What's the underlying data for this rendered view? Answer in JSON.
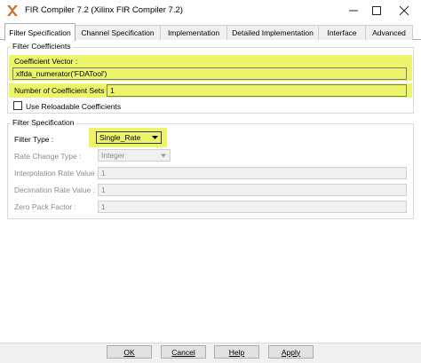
{
  "window": {
    "title": "FIR Compiler 7.2  (Xilinx FIR Compiler 7.2)",
    "minimize_icon": "minimize-icon",
    "maximize_icon": "maximize-icon",
    "close_icon": "close-icon",
    "app_icon": "xilinx-logo-icon"
  },
  "tabs": [
    {
      "label": "Filter Specification",
      "active": true
    },
    {
      "label": "Channel Specification",
      "active": false
    },
    {
      "label": "Implementation",
      "active": false
    },
    {
      "label": "Detailed Implementation",
      "active": false
    },
    {
      "label": "Interface",
      "active": false
    },
    {
      "label": "Advanced",
      "active": false
    }
  ],
  "filter_coefficients": {
    "group_label": "Filter Coefficients",
    "coefficient_vector_label": "Coefficient Vector :",
    "coefficient_vector_value": "xlfda_numerator('FDATool')",
    "num_coefficient_sets_label": "Number of Coefficient Sets :",
    "num_coefficient_sets_value": "1",
    "use_reloadable_label": "Use Reloadable Coefficients",
    "use_reloadable_checked": false
  },
  "filter_specification": {
    "group_label": "Filter Specification",
    "filter_type_label": "Filter Type :",
    "filter_type_value": "Single_Rate",
    "rate_change_type_label": "Rate Change Type :",
    "rate_change_type_value": "Integer",
    "interpolation_rate_label": "Interpolation Rate Value :",
    "interpolation_rate_value": "1",
    "decimation_rate_label": "Decimation Rate Value :",
    "decimation_rate_value": "1",
    "zero_pack_factor_label": "Zero Pack Factor :",
    "zero_pack_factor_value": "1"
  },
  "buttons": {
    "ok": "OK",
    "cancel": "Cancel",
    "help": "Help",
    "apply": "Apply"
  },
  "colors": {
    "highlight": "#ecf56a",
    "disabled_text": "#8a8a8a"
  }
}
